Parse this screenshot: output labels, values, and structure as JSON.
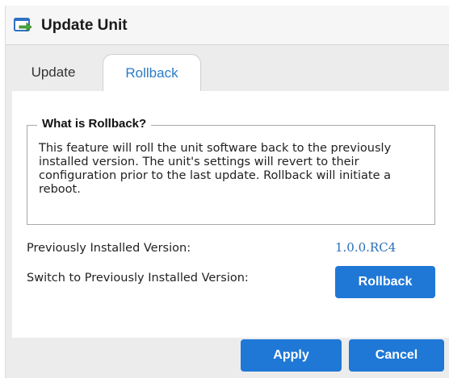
{
  "window": {
    "title": "Update Unit",
    "title_icon": "update-arrow-icon"
  },
  "tabs": [
    {
      "label": "Update",
      "active": false
    },
    {
      "label": "Rollback",
      "active": true
    }
  ],
  "rollback": {
    "section_title": "What is Rollback?",
    "description": "This feature will roll the unit software back to the previously installed version. The unit's settings will revert to their configuration prior to the last update. Rollback will initiate a reboot.",
    "previous_version_label": "Previously Installed Version:",
    "previous_version_value": "1.0.0.RC4",
    "switch_label": "Switch to Previously Installed Version:",
    "rollback_button": "Rollback"
  },
  "footer": {
    "apply_label": "Apply",
    "cancel_label": "Cancel"
  },
  "colors": {
    "accent": "#1f78d6",
    "link": "#2a6db8",
    "icon_green": "#4caa3a",
    "icon_blue": "#2f72c4"
  }
}
